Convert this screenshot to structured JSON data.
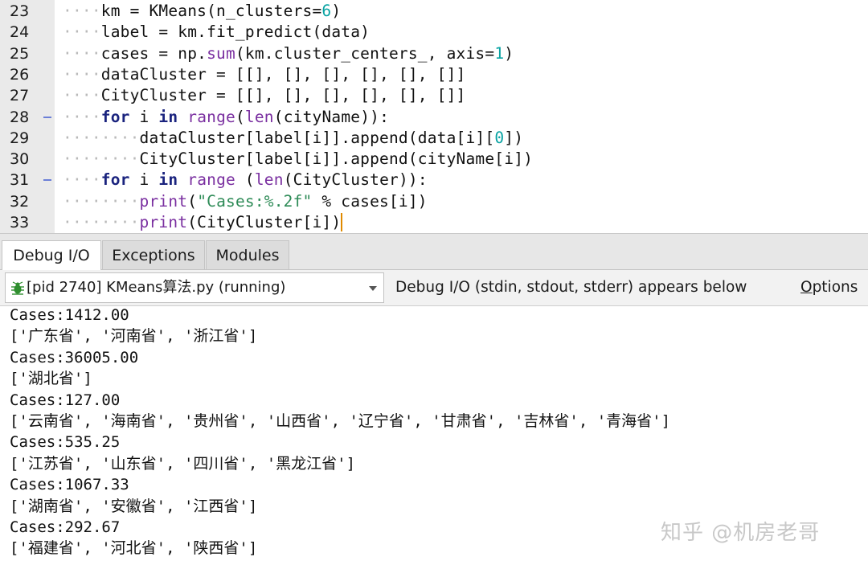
{
  "editor": {
    "lines": [
      {
        "num": "23",
        "fold": false,
        "indent": "····",
        "tokens": [
          {
            "t": "km = KMeans(n_clusters=",
            "c": ""
          },
          {
            "t": "6",
            "c": "num"
          },
          {
            "t": ")",
            "c": ""
          }
        ]
      },
      {
        "num": "24",
        "fold": false,
        "indent": "····",
        "tokens": [
          {
            "t": "label = km.fit_predict(data)",
            "c": ""
          }
        ]
      },
      {
        "num": "25",
        "fold": false,
        "indent": "····",
        "tokens": [
          {
            "t": "cases = np.",
            "c": ""
          },
          {
            "t": "sum",
            "c": "bi"
          },
          {
            "t": "(km.cluster_centers_, axis=",
            "c": ""
          },
          {
            "t": "1",
            "c": "num"
          },
          {
            "t": ")",
            "c": ""
          }
        ]
      },
      {
        "num": "26",
        "fold": false,
        "indent": "····",
        "tokens": [
          {
            "t": "dataCluster = [[], [], [], [], [], []]",
            "c": ""
          }
        ]
      },
      {
        "num": "27",
        "fold": false,
        "indent": "····",
        "tokens": [
          {
            "t": "CityCluster = [[], [], [], [], [], []]",
            "c": ""
          }
        ]
      },
      {
        "num": "28",
        "fold": true,
        "indent": "····",
        "tokens": [
          {
            "t": "for",
            "c": "kw"
          },
          {
            "t": " i ",
            "c": ""
          },
          {
            "t": "in",
            "c": "kw"
          },
          {
            "t": " ",
            "c": ""
          },
          {
            "t": "range",
            "c": "bi"
          },
          {
            "t": "(",
            "c": ""
          },
          {
            "t": "len",
            "c": "bi"
          },
          {
            "t": "(cityName)):",
            "c": ""
          }
        ]
      },
      {
        "num": "29",
        "fold": false,
        "indent": "········",
        "tokens": [
          {
            "t": "dataCluster[label[i]].append(data[i][",
            "c": ""
          },
          {
            "t": "0",
            "c": "num"
          },
          {
            "t": "])",
            "c": ""
          }
        ]
      },
      {
        "num": "30",
        "fold": false,
        "indent": "········",
        "tokens": [
          {
            "t": "CityCluster[label[i]].append(cityName[i])",
            "c": ""
          }
        ]
      },
      {
        "num": "31",
        "fold": true,
        "indent": "····",
        "tokens": [
          {
            "t": "for",
            "c": "kw"
          },
          {
            "t": " i ",
            "c": ""
          },
          {
            "t": "in",
            "c": "kw"
          },
          {
            "t": " ",
            "c": ""
          },
          {
            "t": "range",
            "c": "bi"
          },
          {
            "t": " (",
            "c": ""
          },
          {
            "t": "len",
            "c": "bi"
          },
          {
            "t": "(CityCluster)):",
            "c": ""
          }
        ]
      },
      {
        "num": "32",
        "fold": false,
        "indent": "········",
        "tokens": [
          {
            "t": "print",
            "c": "bi"
          },
          {
            "t": "(",
            "c": ""
          },
          {
            "t": "\"Cases:%.2f\"",
            "c": "str"
          },
          {
            "t": " % cases[i])",
            "c": ""
          }
        ]
      },
      {
        "num": "33",
        "fold": false,
        "indent": "········",
        "tokens": [
          {
            "t": "print",
            "c": "bi"
          },
          {
            "t": "(CityCluster[i])",
            "c": ""
          }
        ]
      }
    ]
  },
  "tabs": [
    {
      "label": "Debug I/O",
      "active": true
    },
    {
      "label": "Exceptions",
      "active": false
    },
    {
      "label": "Modules",
      "active": false
    }
  ],
  "toolbar": {
    "process_label": "[pid 2740] KMeans算法.py (running)",
    "info_text": "Debug I/O (stdin, stdout, stderr) appears below",
    "options_first": "O",
    "options_rest": "ptions"
  },
  "output": {
    "lines": [
      "Cases:1412.00",
      "['广东省', '河南省', '浙江省']",
      "Cases:36005.00",
      "['湖北省']",
      "Cases:127.00",
      "['云南省', '海南省', '贵州省', '山西省', '辽宁省', '甘肃省', '吉林省', '青海省']",
      "Cases:535.25",
      "['江苏省', '山东省', '四川省', '黑龙江省']",
      "Cases:1067.33",
      "['湖南省', '安徽省', '江西省']",
      "Cases:292.67",
      "['福建省', '河北省', '陕西省']"
    ]
  },
  "watermark": "知乎 @机房老哥",
  "icons": {
    "process": "bug-icon",
    "dropdown": "chevron-down-icon"
  }
}
